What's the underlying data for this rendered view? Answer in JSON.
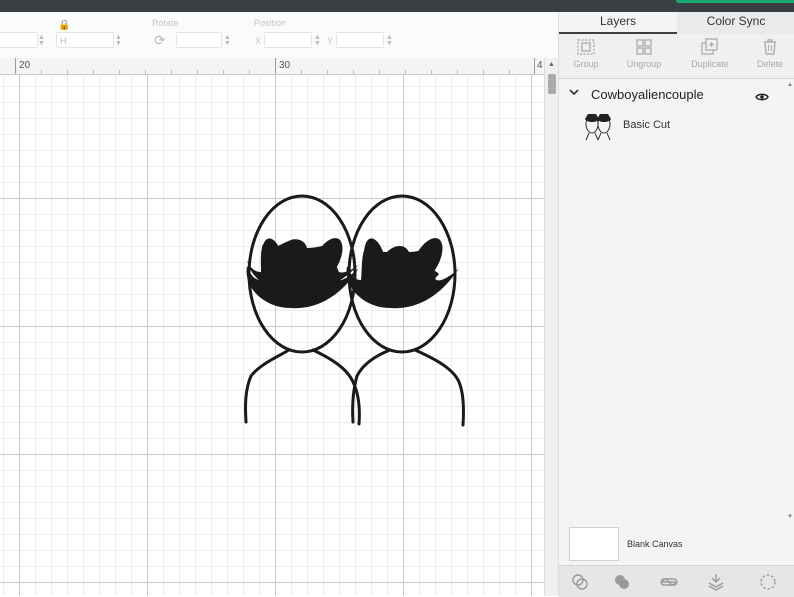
{
  "toolbar": {
    "size_field_label": "H",
    "rotate_label": "Rotate",
    "position_label": "Position",
    "x_label": "X",
    "y_label": "Y"
  },
  "ruler": {
    "marks": [
      "20",
      "30",
      "4"
    ]
  },
  "canvas": {
    "artwork_name": "Cowboyaliencouple"
  },
  "panel": {
    "tabs": [
      {
        "label": "Layers",
        "active": true
      },
      {
        "label": "Color Sync",
        "active": false
      }
    ],
    "actions": [
      {
        "label": "Group",
        "icon": "group-icon"
      },
      {
        "label": "Ungroup",
        "icon": "ungroup-icon"
      },
      {
        "label": "Duplicate",
        "icon": "duplicate-icon"
      },
      {
        "label": "Delete",
        "icon": "trash-icon"
      }
    ],
    "layer_group": {
      "name": "Cowboyaliencouple",
      "layer": {
        "name": "Basic Cut"
      }
    },
    "blank_canvas_label": "Blank Canvas",
    "bottom_icons": [
      "slice-icon",
      "combine-icon",
      "attach-icon",
      "flatten-icon",
      "contour-icon"
    ]
  },
  "colors": {
    "accent": "#1aa875",
    "topbar": "#3a3f44",
    "artwork": "#1a1a1a"
  }
}
